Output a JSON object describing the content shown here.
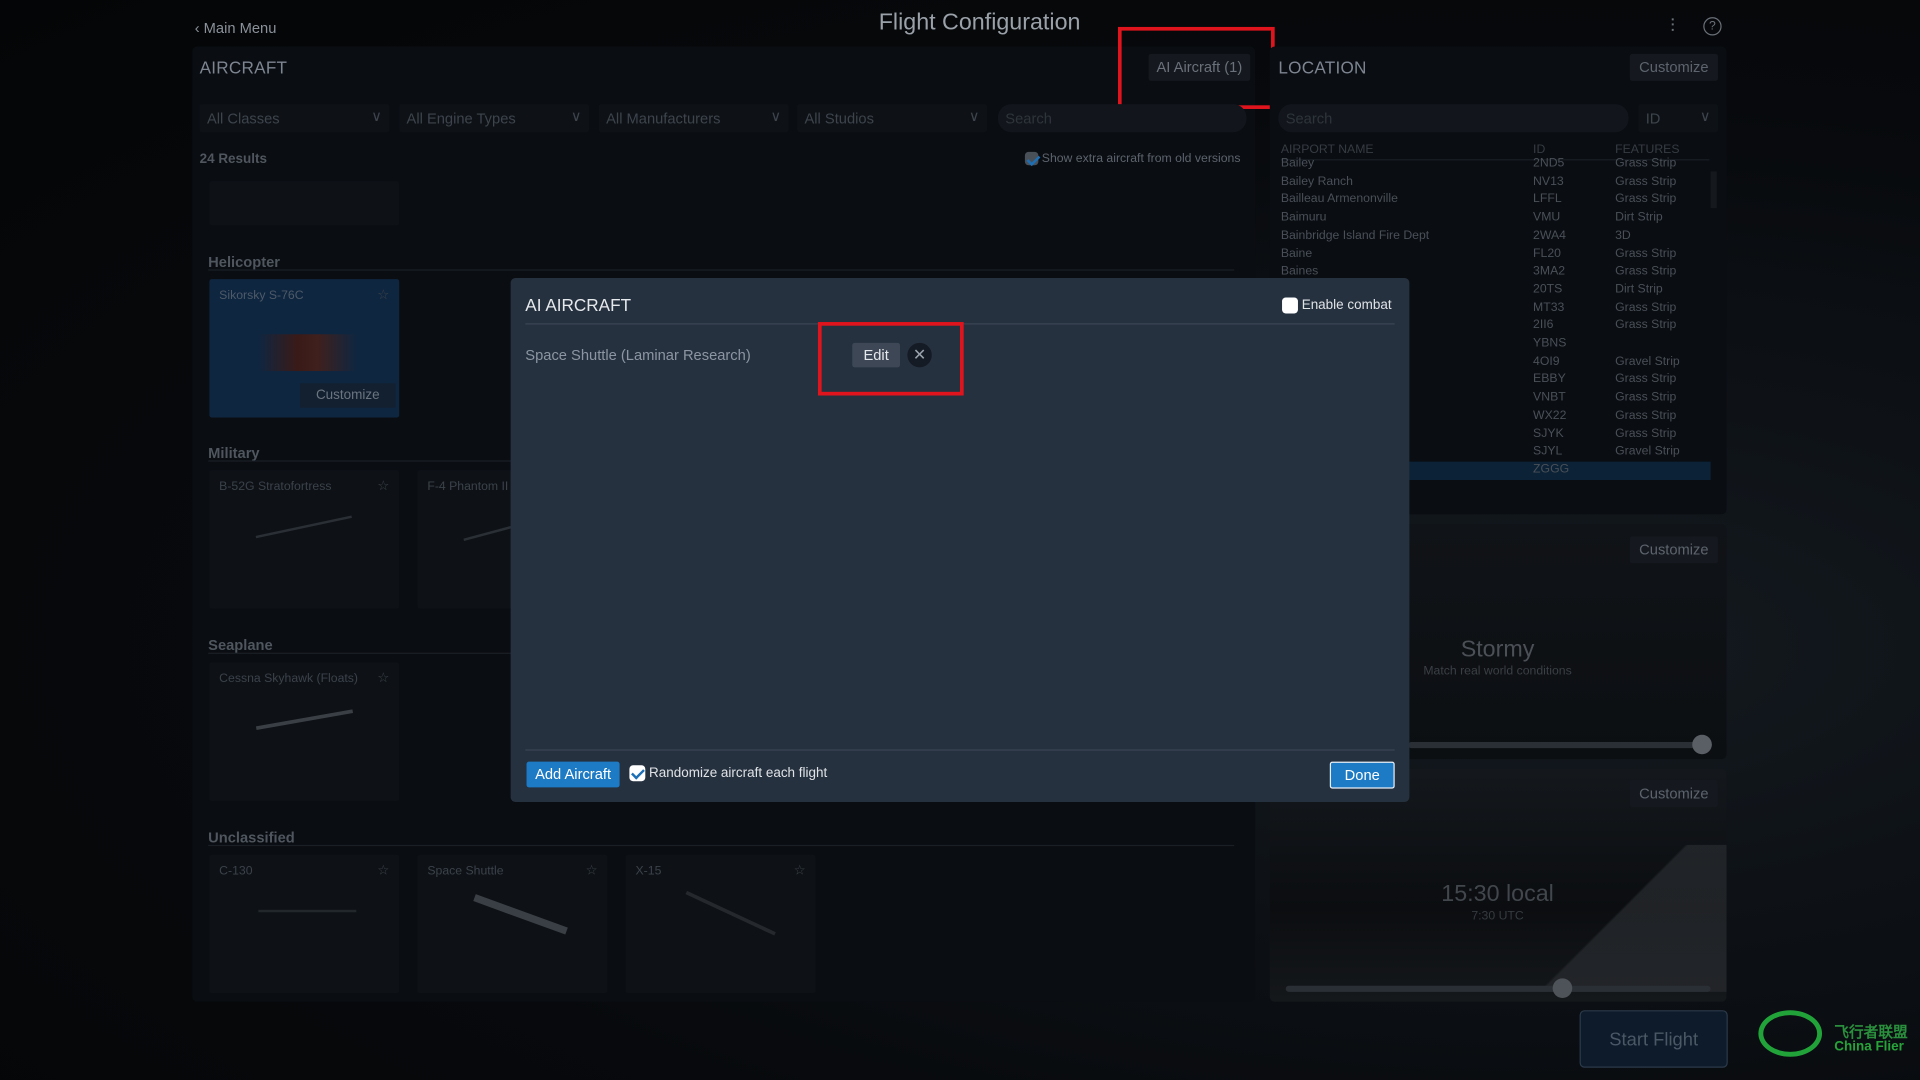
{
  "header": {
    "back_label": "Main Menu",
    "title": "Flight Configuration",
    "icons": [
      "sliders-icon",
      "help-icon"
    ]
  },
  "aircraft": {
    "title": "AIRCRAFT",
    "ai_button": "AI Aircraft (1)",
    "filters": [
      "All Classes",
      "All Engine Types",
      "All Manufacturers",
      "All Studios"
    ],
    "search_placeholder": "Search",
    "results": "24 Results",
    "show_extra": "Show extra aircraft from old versions",
    "categories": [
      {
        "name": "Helicopter",
        "cards": [
          {
            "name": "Sikorsky S-76C",
            "customize": "Customize"
          }
        ]
      },
      {
        "name": "Military",
        "cards": [
          {
            "name": "B-52G Stratofortress"
          },
          {
            "name": "F-4 Phantom II"
          }
        ]
      },
      {
        "name": "Seaplane",
        "cards": [
          {
            "name": "Cessna Skyhawk (Floats)"
          }
        ]
      },
      {
        "name": "Unclassified",
        "cards": [
          {
            "name": "C-130"
          },
          {
            "name": "Space Shuttle"
          },
          {
            "name": "X-15"
          }
        ]
      }
    ]
  },
  "location": {
    "title": "LOCATION",
    "customize": "Customize",
    "search_placeholder": "Search",
    "id_select": "ID",
    "columns": [
      "AIRPORT NAME",
      "ID",
      "FEATURES"
    ],
    "rows": [
      [
        "Bailey",
        "2ND5",
        "Grass Strip"
      ],
      [
        "Bailey Ranch",
        "NV13",
        "Grass Strip"
      ],
      [
        "Bailleau Armenonville",
        "LFFL",
        "Grass Strip"
      ],
      [
        "Baimuru",
        "VMU",
        "Dirt Strip"
      ],
      [
        "Bainbridge Island Fire Dept",
        "2WA4",
        "3D"
      ],
      [
        "Baine",
        "FL20",
        "Grass Strip"
      ],
      [
        "Baines",
        "3MA2",
        "Grass Strip"
      ],
      [
        "",
        "20TS",
        "Dirt Strip"
      ],
      [
        "",
        "MT33",
        "Grass Strip"
      ],
      [
        "",
        "2II6",
        "Grass Strip"
      ],
      [
        "",
        "YBNS",
        ""
      ],
      [
        "",
        "4OI9",
        "Gravel Strip"
      ],
      [
        "",
        "EBBY",
        "Grass Strip"
      ],
      [
        "",
        "VNBT",
        "Grass Strip"
      ],
      [
        "",
        "WX22",
        "Grass Strip"
      ],
      [
        "",
        "SJYK",
        "Grass Strip"
      ],
      [
        "",
        "SJYL",
        "Gravel Strip"
      ],
      [
        "",
        "ZGGG",
        ""
      ]
    ],
    "selected_id": "ZGGG"
  },
  "weather": {
    "customize": "Customize",
    "title": "Stormy",
    "subtitle": "Match real world conditions",
    "slider_value": 1.0
  },
  "time": {
    "customize": "Customize",
    "title": "15:30 local",
    "subtitle": "7:30 UTC",
    "slider_value": 0.65
  },
  "start_flight": "Start Flight",
  "watermark": {
    "cn": "飞行者联盟",
    "en": "China Flier"
  },
  "modal": {
    "title": "AI AIRCRAFT",
    "enable_combat": "Enable combat",
    "enable_combat_checked": false,
    "aircraft": [
      {
        "name": "Space Shuttle (Laminar Research)",
        "edit": "Edit"
      }
    ],
    "add_aircraft": "Add Aircraft",
    "randomize": "Randomize aircraft each flight",
    "randomize_checked": true,
    "done": "Done"
  },
  "colors": {
    "accent": "#1d7ac4",
    "modal_bg": "#263140",
    "highlight": "#e0141c"
  }
}
